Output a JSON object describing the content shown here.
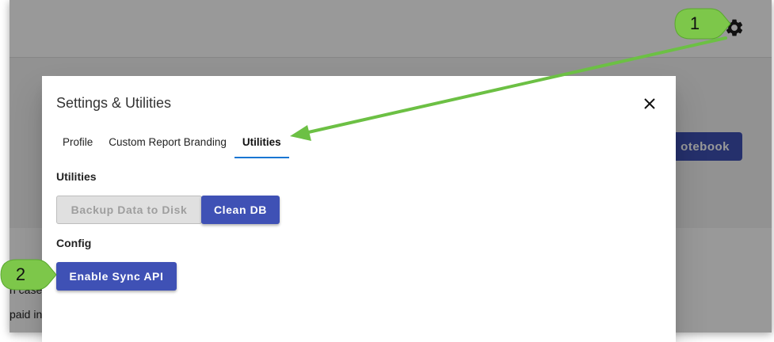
{
  "background": {
    "text_line1": "n case",
    "text_line2": "paid in",
    "button_label": "otebook",
    "gear_icon": "gear-icon"
  },
  "dialog": {
    "title": "Settings & Utilities",
    "close_icon": "close-icon",
    "tabs": [
      {
        "label": "Profile",
        "active": false
      },
      {
        "label": "Custom Report Branding",
        "active": false
      },
      {
        "label": "Utilities",
        "active": true
      }
    ],
    "utilities_heading": "Utilities",
    "backup_label": "Backup Data to Disk",
    "clean_label": "Clean DB",
    "config_heading": "Config",
    "sync_label": "Enable Sync API"
  },
  "annotations": {
    "step1": "1",
    "step2": "2"
  },
  "colors": {
    "primary": "#3f51b5",
    "tab_indicator": "#1976d2",
    "callout_green": "#7dc74a",
    "arrow_green": "#6cc044"
  }
}
